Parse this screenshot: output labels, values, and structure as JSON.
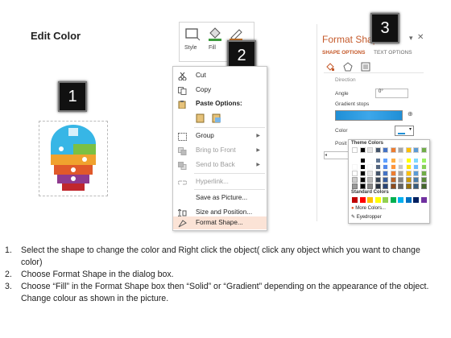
{
  "title": "Edit Color",
  "badges": [
    "1",
    "2",
    "3"
  ],
  "ribbon": {
    "style_label": "Style",
    "fill_label": "Fill",
    "outline_label": "O"
  },
  "context_menu": {
    "items": [
      {
        "label": "Cut",
        "icon": "scissors-icon"
      },
      {
        "label": "Copy",
        "icon": "copy-icon"
      },
      {
        "label": "Paste Options:",
        "icon": "paste-icon"
      },
      {
        "label": "Group",
        "icon": "group-icon"
      },
      {
        "label": "Bring to Front",
        "icon": "bring-front-icon"
      },
      {
        "label": "Send to Back",
        "icon": "send-back-icon"
      },
      {
        "label": "Hyperlink...",
        "icon": "link-icon"
      },
      {
        "label": "Save as Picture...",
        "icon": "save-picture-icon"
      },
      {
        "label": "Size and Position...",
        "icon": "size-icon"
      },
      {
        "label": "Format Shape...",
        "icon": "format-shape-icon"
      }
    ]
  },
  "format_pane": {
    "title": "Format Shap",
    "tab_options": "SHAPE OPTIONS",
    "tab_text": "TEXT OPTIONS",
    "direction_label": "Direction",
    "angle_label": "Angle",
    "angle_value": "0°",
    "gradient_stops_label": "Gradient stops",
    "color_label": "Color",
    "position_label": "Posit",
    "theme_colors_label": "Theme Colors",
    "standard_colors_label": "Standard Colors",
    "more_colors_label": "More Colors...",
    "eyedropper_label": "Eyedropper"
  },
  "colors": {
    "accent": "#c55a2b",
    "menu_highlight": "#fbe3d6",
    "bulb": [
      "#37b6e6",
      "#7bc043",
      "#f0a22e",
      "#e0592a",
      "#8e3a8e",
      "#c0272d"
    ]
  },
  "instructions": [
    {
      "num": "1.",
      "text": "Select the shape to change the color and Right click the object( click any object which you want to change color)"
    },
    {
      "num": "2.",
      "text": "Choose Format Shape in the dialog box."
    },
    {
      "num": "3.",
      "text": "Choose “Fill” in the Format Shape box then “Solid” or “Gradient” depending on the appearance of the object. Change colour as shown in the picture."
    }
  ]
}
